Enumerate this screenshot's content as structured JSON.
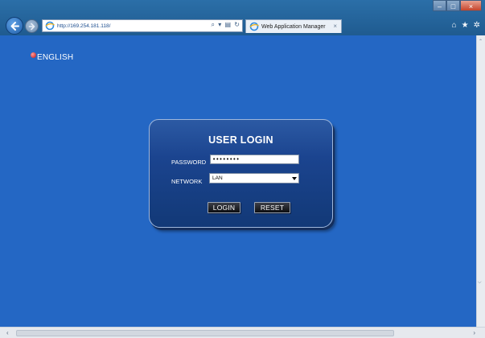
{
  "browser": {
    "address_url": "http://169.254.181.118/",
    "tab_title": "Web Application Manager",
    "tab_close": "×",
    "window_controls": {
      "minimize": "–",
      "maximize": "□",
      "close": "×"
    },
    "address_tools": {
      "search": "⌕",
      "dropdown": "▾",
      "compat": "▤",
      "refresh": "↻"
    },
    "toolbar": {
      "home": "⌂",
      "favorites": "★",
      "settings": "✲"
    },
    "icons": [
      "back-arrow-icon",
      "forward-arrow-icon",
      "ie-site-icon",
      "home-icon",
      "star-icon",
      "gear-icon"
    ]
  },
  "page": {
    "language_label": "ENGLISH",
    "login": {
      "title": "USER LOGIN",
      "password_label": "PASSWORD",
      "password_value": "••••••••",
      "network_label": "NETWORK",
      "network_value": "LAN",
      "login_button": "LOGIN",
      "reset_button": "RESET"
    }
  },
  "scrollbars": {
    "left_arrow": "‹",
    "right_arrow": "›",
    "top_mark": "⌃",
    "side_mark": "⌵"
  },
  "colors": {
    "page_background": "#2467c4",
    "panel_background": "#1b448f",
    "chrome": "#1f5b90"
  }
}
